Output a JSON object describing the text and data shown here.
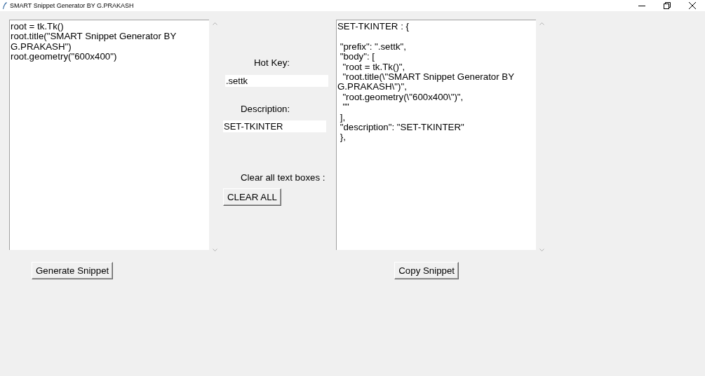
{
  "window": {
    "title": "SMART Snippet Generator BY G.PRAKASH"
  },
  "code_input": {
    "text": "root = tk.Tk()\nroot.title(\"SMART Snippet Generator BY G.PRAKASH\")\nroot.geometry(\"600x400\")"
  },
  "hot_key": {
    "label": "Hot Key:",
    "value": ".settk"
  },
  "description": {
    "label": "Description:",
    "value": "SET-TKINTER"
  },
  "clear": {
    "label": "Clear all text boxes :",
    "button": "CLEAR ALL"
  },
  "snippet_output": {
    "text": "SET-TKINTER : {\n\n \"prefix\": \".settk\",\n \"body\": [\n  \"root = tk.Tk()\",\n  \"root.title(\\\"SMART Snippet Generator BY G.PRAKASH\\\")\",\n  \"root.geometry(\\\"600x400\\\")\",\n  \"\"\n ],\n \"description\": \"SET-TKINTER\"\n },"
  },
  "buttons": [
    {
      "label": "Generate Snippet"
    },
    {
      "label": "Copy Snippet"
    }
  ]
}
